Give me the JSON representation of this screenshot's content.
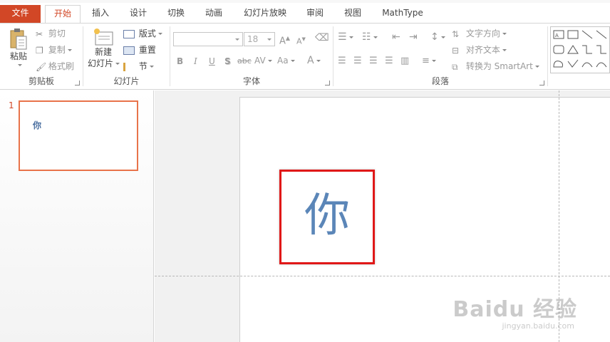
{
  "tabs": {
    "file": "文件",
    "home": "开始",
    "insert": "插入",
    "design": "设计",
    "transitions": "切换",
    "animations": "动画",
    "slideshow": "幻灯片放映",
    "review": "审阅",
    "view": "视图",
    "mathtype": "MathType"
  },
  "clipboard": {
    "paste": "粘贴",
    "cut": "剪切",
    "copy": "复制",
    "format_painter": "格式刷",
    "label": "剪贴板"
  },
  "slides": {
    "new_slide_line1": "新建",
    "new_slide_line2": "幻灯片",
    "layout": "版式",
    "reset": "重置",
    "section": "节",
    "label": "幻灯片"
  },
  "font": {
    "size": "18",
    "grow": "A",
    "shrink": "A",
    "bold": "B",
    "italic": "I",
    "underline": "U",
    "shadow": "S",
    "strike": "abc",
    "spacing": "AV",
    "case": "Aa",
    "color": "A",
    "label": "字体"
  },
  "paragraph": {
    "text_direction": "文字方向",
    "align_text": "对齐文本",
    "convert_smartart": "转换为 SmartArt",
    "label": "段落"
  },
  "thumbnail": {
    "number": "1",
    "text": "你"
  },
  "slide": {
    "text": "你"
  },
  "watermark": {
    "main": "Baidu 经验",
    "url": "jingyan.baidu.com"
  },
  "colors": {
    "accent": "#d24726",
    "highlight": "#e01818",
    "slide_text": "#5b86b8"
  }
}
